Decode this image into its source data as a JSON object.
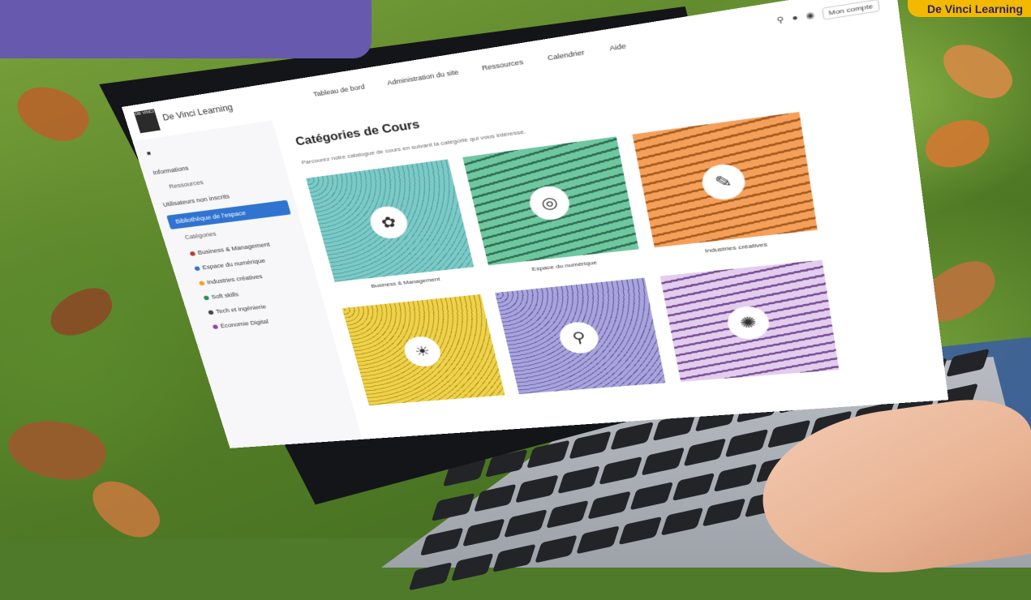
{
  "overlay": {
    "brand_tag": "De Vinci Learning",
    "banner_color": "#6659ae",
    "brand_tag_color": "#f4b800"
  },
  "screen": {
    "logo_text": "DE VINCI",
    "brand": "De Vinci Learning",
    "nav": [
      "Tableau de bord",
      "Administration du site",
      "Ressources",
      "Calendrier",
      "Aide"
    ],
    "top_icons": [
      "search-icon",
      "notification-icon",
      "avatar"
    ],
    "user_label": "Mon compte",
    "sidebar": {
      "section": "Informations",
      "item_1": "Ressources",
      "group": "Utilisateurs non inscrits",
      "active": "Bibliothèque de l'espace",
      "item_2": "Catégories",
      "categories": [
        {
          "label": "Business & Management",
          "color": "#c0392b"
        },
        {
          "label": "Espace du numérique",
          "color": "#2f74d0"
        },
        {
          "label": "Industries créatives",
          "color": "#f0a020"
        },
        {
          "label": "Soft skills",
          "color": "#2e8b57"
        },
        {
          "label": "Tech et ingénierie",
          "color": "#444444"
        },
        {
          "label": "Économie Digital",
          "color": "#8e44ad"
        }
      ]
    },
    "main": {
      "title": "Catégories de Cours",
      "intro": "Parcourez notre catalogue de cours en suivant la catégorie qui vous intéresse.",
      "cards": [
        {
          "label": "Business & Management",
          "color": "#7ccac7",
          "icon": "✿"
        },
        {
          "label": "Espace du numérique",
          "color": "#6fc79e",
          "icon": "◎"
        },
        {
          "label": "Industries créatives",
          "color": "#f5a05a",
          "icon": "✎"
        },
        {
          "label": "",
          "color": "#f0d24a",
          "icon": "☀"
        },
        {
          "label": "",
          "color": "#a9a4dc",
          "icon": "⚲"
        },
        {
          "label": "",
          "color": "#c6a5d8",
          "icon": "✺"
        }
      ]
    }
  }
}
